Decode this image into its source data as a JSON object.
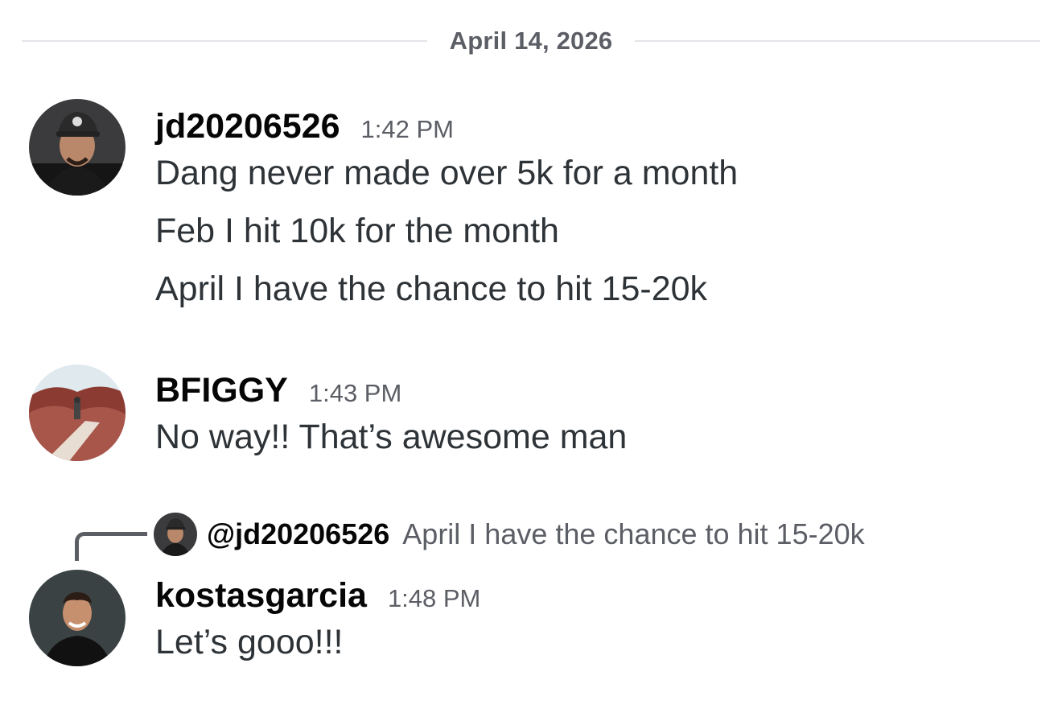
{
  "date_divider": "April 14, 2026",
  "messages": [
    {
      "username": "jd20206526",
      "timestamp": "1:42 PM",
      "lines": [
        "Dang never made over 5k for a month",
        "Feb I hit 10k for the month",
        "April I have the chance to hit 15-20k"
      ]
    },
    {
      "username": "BFIGGY",
      "timestamp": "1:43 PM",
      "lines": [
        "No way!! That’s awesome man"
      ]
    },
    {
      "username": "kostasgarcia",
      "timestamp": "1:48 PM",
      "reply": {
        "author": "@jd20206526",
        "text": "April I have the chance to hit 15-20k"
      },
      "lines": [
        "Let’s gooo!!!"
      ]
    }
  ],
  "colors": {
    "username": "#060607",
    "text": "#2e3338",
    "muted": "#5c5e66",
    "divider": "#e3e5e8"
  }
}
